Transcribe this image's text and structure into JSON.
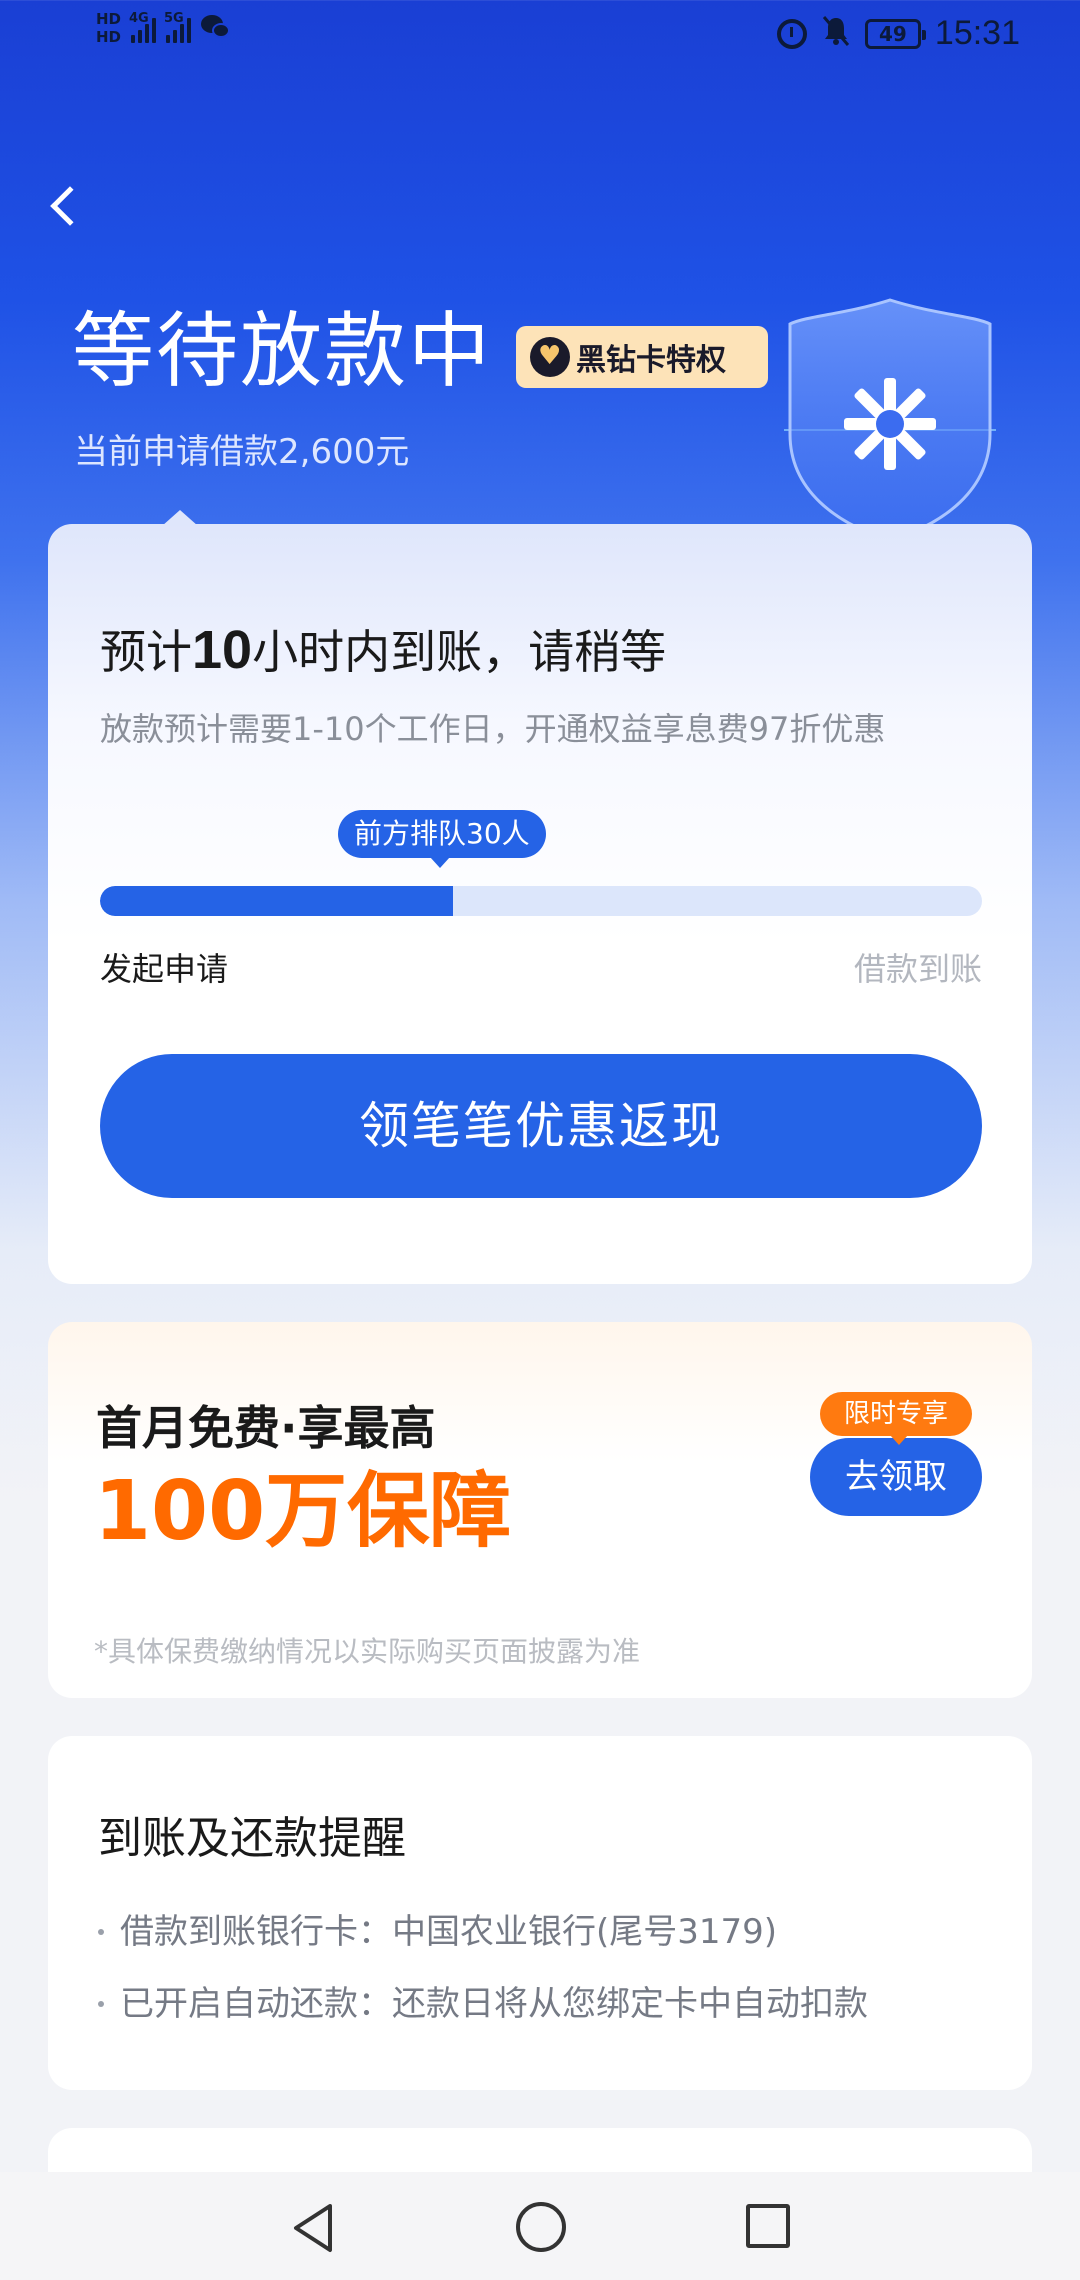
{
  "status_bar": {
    "hd_top": "HD",
    "hd_bottom": "HD",
    "sig1_label": "4G",
    "sig2_label": "5G",
    "battery": "49",
    "time": "15:31"
  },
  "header": {
    "title": "等待放款中",
    "badge": "黑钻卡特权",
    "subtitle": "当前申请借款2,600元"
  },
  "status_card": {
    "eta_prefix": "预计",
    "eta_hours": "10",
    "eta_suffix": "小时内到账，请稍等",
    "eta_sub": "放款预计需要1-10个工作日，开通权益享息费97折优惠",
    "queue_label": "前方排队30人",
    "progress_fraction": 0.4,
    "progress_start": "发起申请",
    "progress_end": "借款到账",
    "cta": "领笔笔优惠返现"
  },
  "insurance_card": {
    "title": "首月免费·享最高",
    "amount": "100万保障",
    "tag": "限时专享",
    "button": "去领取",
    "note": "*具体保费缴纳情况以实际购买页面披露为准"
  },
  "reminder_card": {
    "title": "到账及还款提醒",
    "items": [
      "借款到账银行卡：中国农业银行(尾号3179)",
      "已开启自动还款：还款日将从您绑定卡中自动扣款"
    ]
  },
  "colors": {
    "primary": "#2563e6",
    "accent_orange": "#ff6a00",
    "header_blue": "#1a3fd4"
  }
}
